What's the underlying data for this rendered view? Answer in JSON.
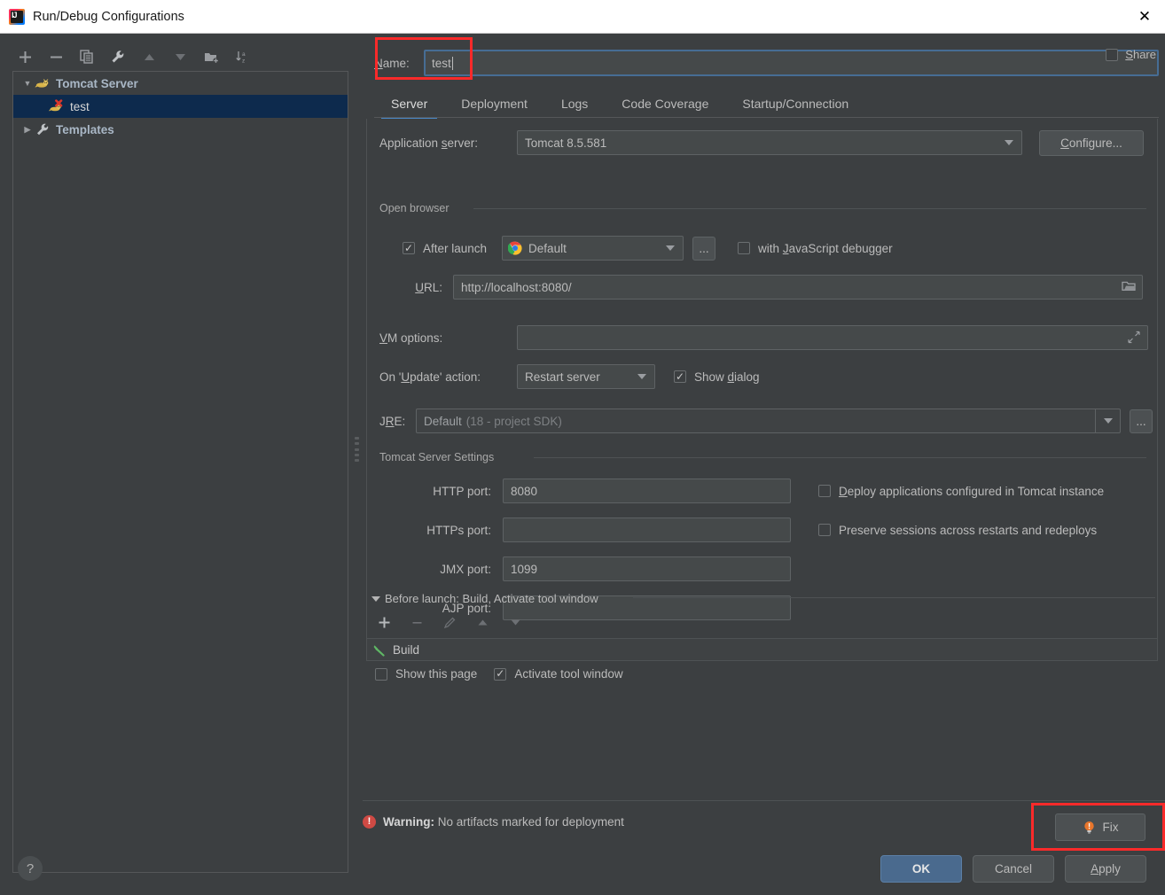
{
  "window": {
    "title": "Run/Debug Configurations",
    "close_label": "✕",
    "app_icon": "intellij-idea-icon"
  },
  "left_panel": {
    "toolbar": [
      {
        "name": "add-configuration-button",
        "glyph": "+"
      },
      {
        "name": "remove-configuration-button",
        "glyph": "−"
      },
      {
        "name": "copy-configuration-button",
        "glyph": "copy-icon"
      },
      {
        "name": "edit-templates-button",
        "glyph": "wrench-icon"
      },
      {
        "name": "move-up-button",
        "glyph": "▲"
      },
      {
        "name": "move-down-button",
        "glyph": "▼"
      },
      {
        "name": "new-folder-button",
        "glyph": "folder-plus-icon"
      },
      {
        "name": "sort-configurations-button",
        "glyph": "sort-az-icon"
      }
    ],
    "tree": [
      {
        "label": "Tomcat Server",
        "type": "group",
        "expanded": true,
        "twisty": "▼",
        "icon": "tomcat-icon"
      },
      {
        "label": "test",
        "type": "item",
        "selected": true,
        "icon": "tomcat-error-icon"
      },
      {
        "label": "Templates",
        "type": "group",
        "expanded": false,
        "twisty": "▶",
        "icon": "wrench-icon"
      }
    ]
  },
  "name_row": {
    "label": "Name:",
    "label_mnemonic": "N",
    "value": "test",
    "share_label": "Share",
    "share_mnemonic": "S",
    "share_checked": false
  },
  "tabs": [
    {
      "label": "Server",
      "active": true
    },
    {
      "label": "Deployment",
      "active": false
    },
    {
      "label": "Logs",
      "active": false
    },
    {
      "label": "Code Coverage",
      "active": false
    },
    {
      "label": "Startup/Connection",
      "active": false
    }
  ],
  "server_tab": {
    "application_server": {
      "label": "Application server:",
      "label_mnemonic": "s",
      "value": "Tomcat 8.5.581",
      "configure_button": "Configure...",
      "configure_mnemonic": "C"
    },
    "open_browser": {
      "group_title": "Open browser",
      "after_launch_label": "After launch",
      "after_launch_checked": true,
      "browser_value": "Default",
      "browser_icon": "chrome-icon",
      "browse_button": "...",
      "js_debugger_label": "with JavaScript debugger",
      "js_debugger_mnemonic": "J",
      "js_debugger_checked": false,
      "url_label": "URL:",
      "url_mnemonic": "U",
      "url_value": "http://localhost:8080/",
      "url_browse_icon": "folder-icon"
    },
    "vm_options": {
      "label": "VM options:",
      "label_mnemonic": "V",
      "value": "",
      "expand_icon": "expand-arrows-icon"
    },
    "update_action": {
      "label": "On 'Update' action:",
      "label_mnemonic": "U",
      "value": "Restart server",
      "show_dialog_label": "Show dialog",
      "show_dialog_mnemonic": "d",
      "show_dialog_checked": true
    },
    "jre": {
      "label": "JRE:",
      "label_mnemonic": "R",
      "value": "Default",
      "value_hint": "(18 - project SDK)",
      "browse_button": "..."
    },
    "tomcat_settings": {
      "group_title": "Tomcat Server Settings",
      "fields": [
        {
          "label": "HTTP port:",
          "value": "8080",
          "name": "http-port-input"
        },
        {
          "label": "HTTPs port:",
          "value": "",
          "name": "https-port-input"
        },
        {
          "label": "JMX port:",
          "value": "1099",
          "name": "jmx-port-input"
        },
        {
          "label": "AJP port:",
          "value": "",
          "name": "ajp-port-input"
        }
      ],
      "checkboxes": [
        {
          "label": "Deploy applications configured in Tomcat instance",
          "mnemonic": "D",
          "checked": false,
          "name": "deploy-applications-checkbox"
        },
        {
          "label": "Preserve sessions across restarts and redeploys",
          "mnemonic": "",
          "checked": false,
          "name": "preserve-sessions-checkbox"
        }
      ]
    }
  },
  "before_launch": {
    "header": "Before launch: Build, Activate tool window",
    "header_mnemonic": "B",
    "twisty": "▼",
    "toolbar": [
      {
        "name": "before-launch-add-button",
        "glyph": "+",
        "enabled": true
      },
      {
        "name": "before-launch-remove-button",
        "glyph": "−",
        "enabled": false
      },
      {
        "name": "before-launch-edit-button",
        "glyph": "pencil-icon",
        "enabled": false
      },
      {
        "name": "before-launch-move-up-button",
        "glyph": "▲",
        "enabled": false
      },
      {
        "name": "before-launch-move-down-button",
        "glyph": "▼",
        "enabled": false
      }
    ],
    "tasks": [
      {
        "label": "Build",
        "icon": "build-hammer-icon"
      }
    ],
    "show_this_page_label": "Show this page",
    "show_this_page_checked": false,
    "activate_tool_window_label": "Activate tool window",
    "activate_tool_window_checked": true
  },
  "status": {
    "warning_prefix": "Warning:",
    "warning_text": "No artifacts marked for deployment",
    "warning_icon": "error-circle-icon",
    "fix_label": "Fix",
    "fix_icon": "lightbulb-icon"
  },
  "footer": {
    "help_label": "?",
    "ok_label": "OK",
    "cancel_label": "Cancel",
    "apply_label": "Apply",
    "apply_mnemonic": "A"
  },
  "annotations": {
    "accent_red": "#fa2a2a",
    "boxes": [
      "name-field-highlight",
      "fix-button-highlight"
    ]
  },
  "colors": {
    "dialog_bg": "#3c3f41",
    "field_bg": "#45494a",
    "selection_blue": "#0d2a4d",
    "accent_blue": "#4a88c7",
    "ok_button": "#4a6a8e",
    "warning_red": "#cf4a44"
  }
}
